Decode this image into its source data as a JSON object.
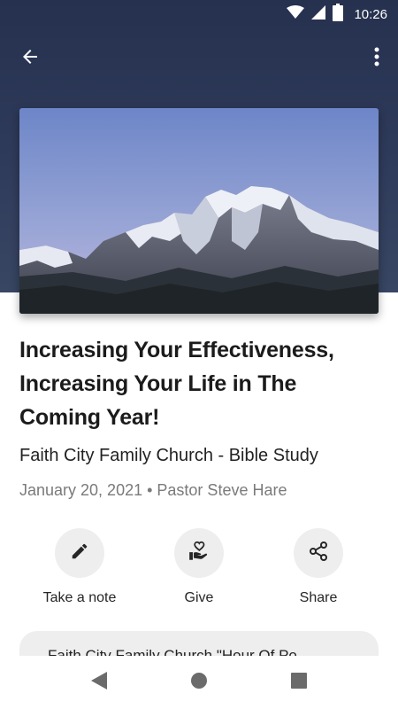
{
  "status_bar": {
    "time": "10:26"
  },
  "toolbar": {
    "back_icon": "arrow-left-icon",
    "more_icon": "more-vertical-icon"
  },
  "hero": {
    "image": "snowy-mountain-landscape"
  },
  "sermon": {
    "title": "Increasing Your Effectiveness, Increasing Your Life in The Coming Year!",
    "subtitle": "Faith City Family Church - Bible Study",
    "meta": "January 20, 2021 • Pastor Steve Hare"
  },
  "actions": [
    {
      "label": "Take a note",
      "icon": "pencil-icon"
    },
    {
      "label": "Give",
      "icon": "hand-heart-icon"
    },
    {
      "label": "Share",
      "icon": "share-icon"
    }
  ],
  "series_card": {
    "label": "Faith City Family Church \"Hour Of Po"
  },
  "colors": {
    "header": "#2f3b5b",
    "action_circle": "#eeeeee",
    "meta_text": "#7a7a7a"
  }
}
